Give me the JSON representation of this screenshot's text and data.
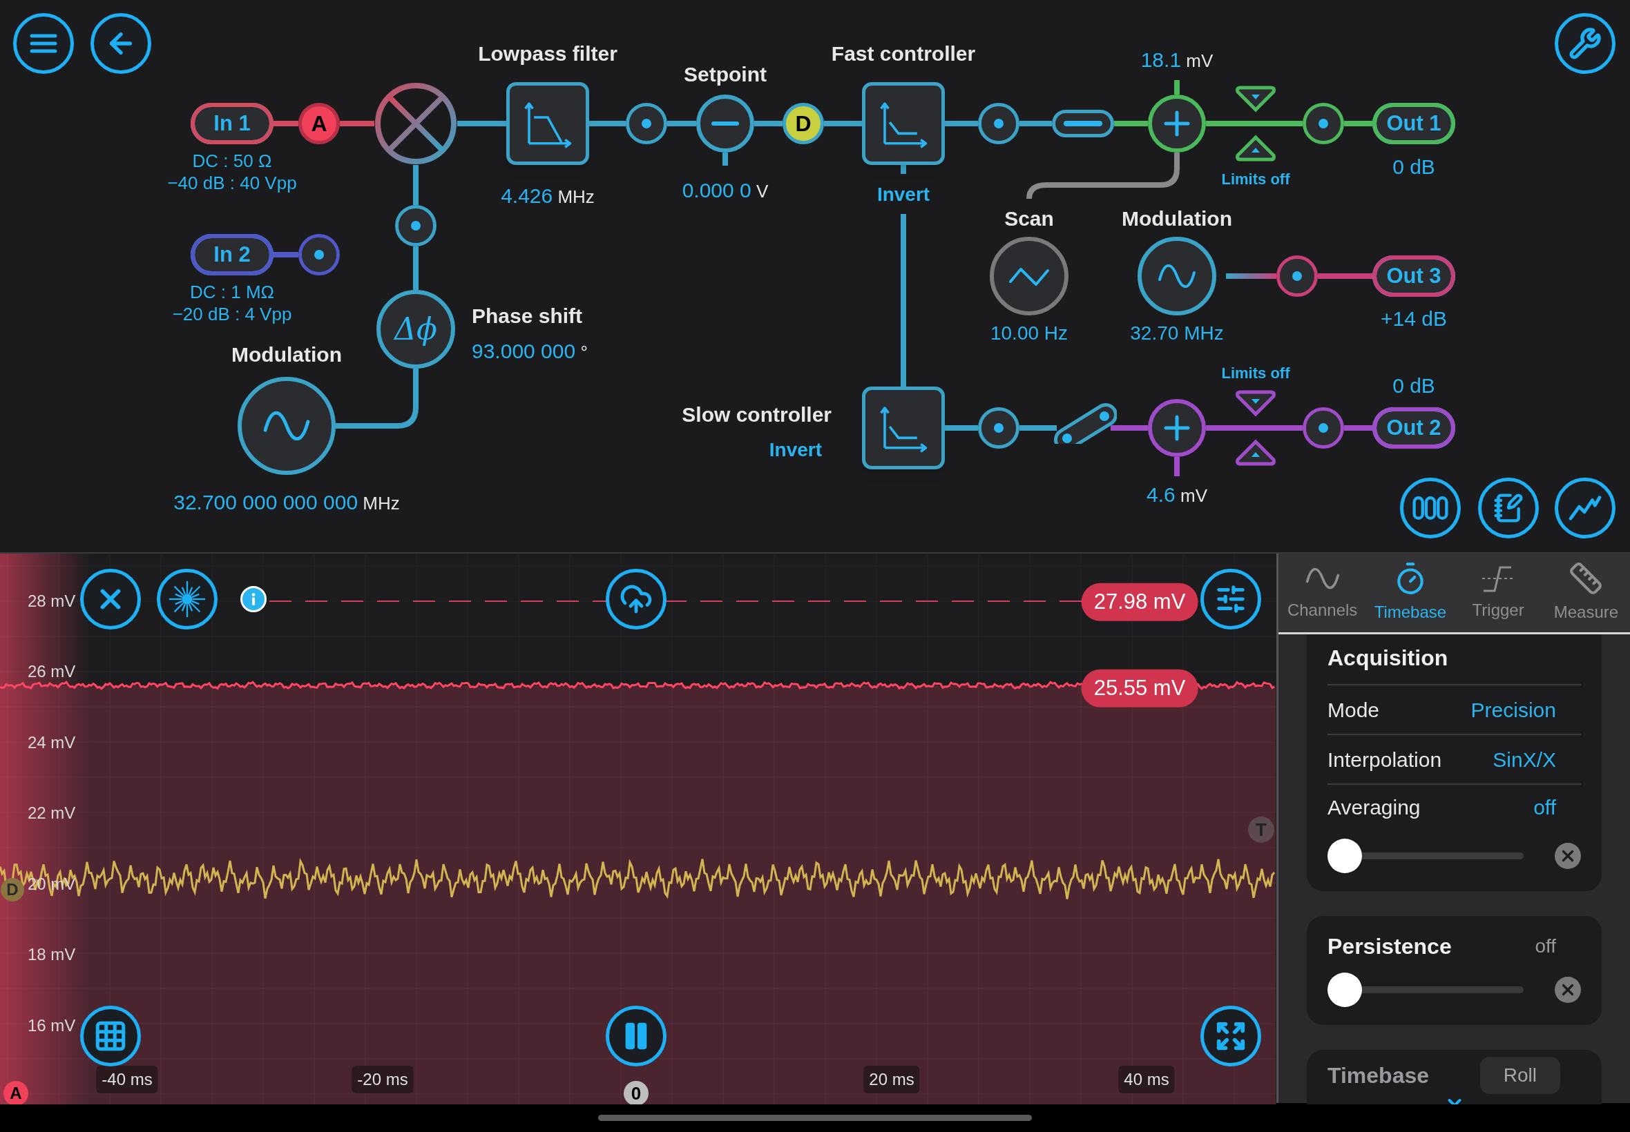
{
  "diagram": {
    "inputs": [
      {
        "label": "In 1",
        "coupling": "DC : 50 Ω",
        "range": "−40 dB : 40 Vpp"
      },
      {
        "label": "In 2",
        "coupling": "DC : 1 MΩ",
        "range": "−20 dB : 4 Vpp"
      }
    ],
    "input_badge": "A",
    "lowpass_filter": {
      "title": "Lowpass filter",
      "value": "4.426",
      "unit": "MHz"
    },
    "setpoint": {
      "title": "Setpoint",
      "value": "0.000 0",
      "unit": "V"
    },
    "setpoint_badge": "D",
    "fast_controller": {
      "title": "Fast controller",
      "invert": "Invert"
    },
    "phase_shift": {
      "title": "Phase shift",
      "symbol": "Δϕ",
      "value": "93.000 000",
      "unit": "°"
    },
    "modulation_in": {
      "title": "Modulation",
      "value": "32.700 000 000 000",
      "unit": "MHz"
    },
    "slow_controller": {
      "title": "Slow controller",
      "invert": "Invert"
    },
    "scan": {
      "title": "Scan",
      "value": "10.00 Hz"
    },
    "modulation_out": {
      "title": "Modulation",
      "value": "32.70 MHz"
    },
    "sums": [
      {
        "value": "18.1",
        "unit": "mV",
        "limits": "Limits off"
      },
      {
        "value": "4.6",
        "unit": "mV",
        "limits": "Limits off"
      }
    ],
    "outputs": [
      {
        "label": "Out 1",
        "gain": "0 dB"
      },
      {
        "label": "Out 3",
        "gain": "+14 dB"
      },
      {
        "label": "Out 2",
        "gain": "0 dB"
      }
    ]
  },
  "scope": {
    "y_axis": [
      "28 mV",
      "26 mV",
      "24 mV",
      "22 mV",
      "20 mV",
      "18 mV",
      "16 mV"
    ],
    "x_axis": [
      "-40 ms",
      "-20 ms",
      "20 ms",
      "40 ms"
    ],
    "zero_marker": "0",
    "trigger_marker": "T",
    "channel_markers": [
      "D",
      "A"
    ],
    "cursor_readouts": [
      "27.98 mV",
      "25.55 mV"
    ]
  },
  "panel": {
    "tabs": [
      {
        "label": "Channels",
        "selected": false
      },
      {
        "label": "Timebase",
        "selected": true
      },
      {
        "label": "Trigger",
        "selected": false
      },
      {
        "label": "Measure",
        "selected": false
      }
    ],
    "acquisition": {
      "title": "Acquisition",
      "rows": [
        {
          "label": "Mode",
          "value": "Precision"
        },
        {
          "label": "Interpolation",
          "value": "SinX/X"
        }
      ],
      "averaging": {
        "label": "Averaging",
        "value": "off",
        "level": 0
      }
    },
    "persistence": {
      "title": "Persistence",
      "value": "off",
      "level": 0
    },
    "timebase": {
      "title": "Timebase",
      "mode": "Roll"
    }
  }
}
